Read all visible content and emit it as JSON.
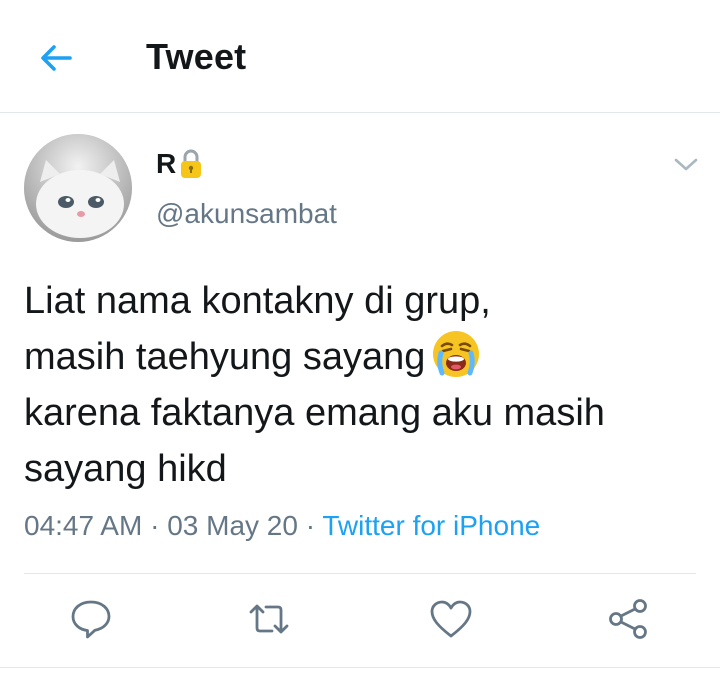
{
  "header": {
    "title": "Tweet"
  },
  "tweet": {
    "author": {
      "display_name": "R",
      "handle": "@akunsambat",
      "protected": true
    },
    "text_lines": [
      "Liat nama kontakny di grup,",
      "masih taehyung sayang",
      "karena faktanya emang aku masih",
      "sayang hikd"
    ],
    "time": "04:47 AM",
    "date": "03 May 20",
    "separator": "·",
    "source": "Twitter for iPhone"
  },
  "actions": [
    "reply-icon",
    "retweet-icon",
    "like-icon",
    "share-icon"
  ],
  "colors": {
    "accent": "#1da1f2",
    "secondary_text": "#657786",
    "divider": "#e1e8ed"
  }
}
